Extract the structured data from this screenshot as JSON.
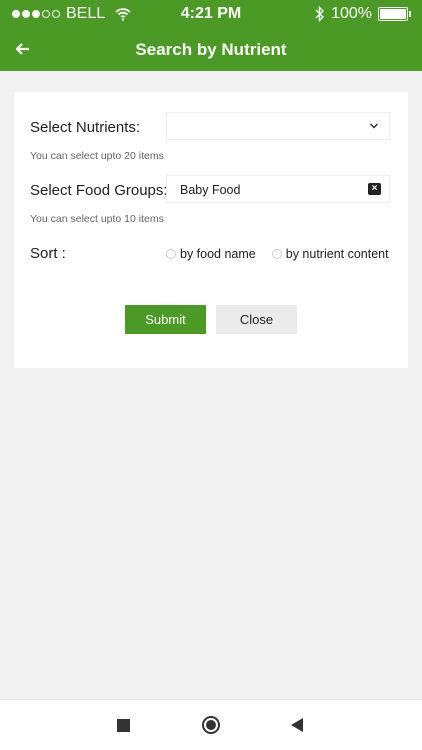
{
  "status_bar": {
    "carrier": "BELL",
    "time": "4:21 PM",
    "battery": "100%",
    "battery_level": 100
  },
  "header": {
    "title": "Search by Nutrient",
    "back_icon": "arrow-left-icon"
  },
  "form": {
    "nutrients": {
      "label": "Select Nutrients:",
      "value": "",
      "hint": "You can select upto 20 items"
    },
    "food_groups": {
      "label": "Select Food Groups:",
      "selected": "Baby Food",
      "hint": "You can select upto 10 items"
    },
    "sort": {
      "label": "Sort :",
      "options": [
        "by food name",
        "by nutrient content"
      ]
    },
    "submit_label": "Submit",
    "close_label": "Close"
  },
  "colors": {
    "brand": "#4a9a25",
    "background": "#f2f2f2"
  }
}
